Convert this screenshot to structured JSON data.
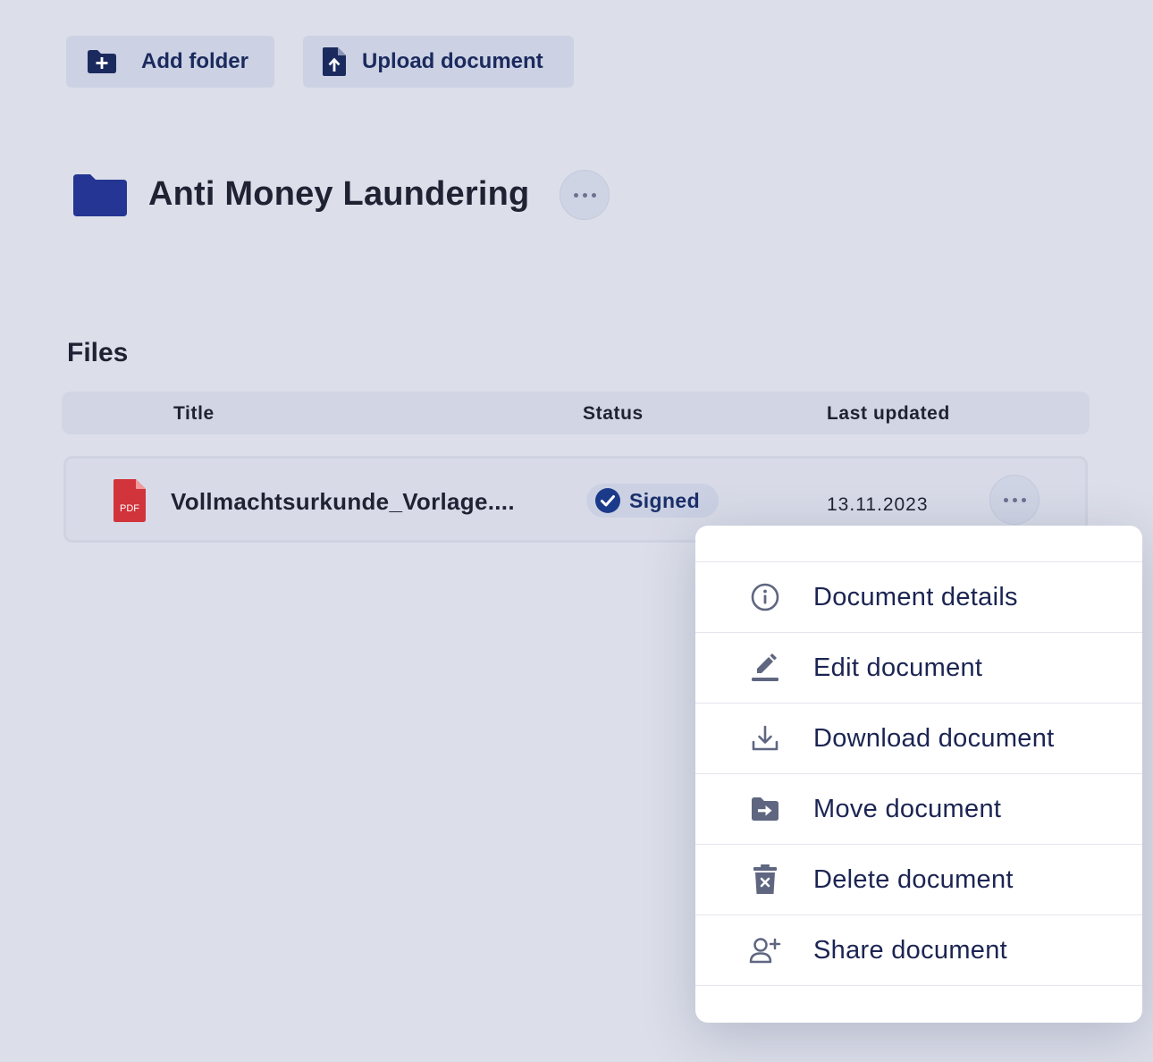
{
  "toolbar": {
    "add_folder_label": "Add folder",
    "upload_document_label": "Upload document"
  },
  "folder": {
    "title": "Anti Money Laundering",
    "icon": "folder-icon",
    "color": "#253593"
  },
  "files": {
    "heading": "Files",
    "columns": {
      "title": "Title",
      "status": "Status",
      "last_updated": "Last updated"
    },
    "rows": [
      {
        "file_type": "PDF",
        "name": "Vollmachtsurkunde_Vorlage....",
        "status": "Signed",
        "last_updated": "13.11.2023"
      }
    ]
  },
  "context_menu": {
    "items": [
      {
        "label": "Document details",
        "icon": "info-icon"
      },
      {
        "label": "Edit document",
        "icon": "pencil-icon"
      },
      {
        "label": "Download document",
        "icon": "download-icon"
      },
      {
        "label": "Move document",
        "icon": "move-folder-icon"
      },
      {
        "label": "Delete document",
        "icon": "trash-icon"
      },
      {
        "label": "Share document",
        "icon": "add-user-icon"
      }
    ]
  },
  "colors": {
    "background": "#dcdfe9",
    "accent": "#1b2a5e",
    "pdf_red": "#d1343a",
    "signed_blue": "#1b3a8a"
  }
}
